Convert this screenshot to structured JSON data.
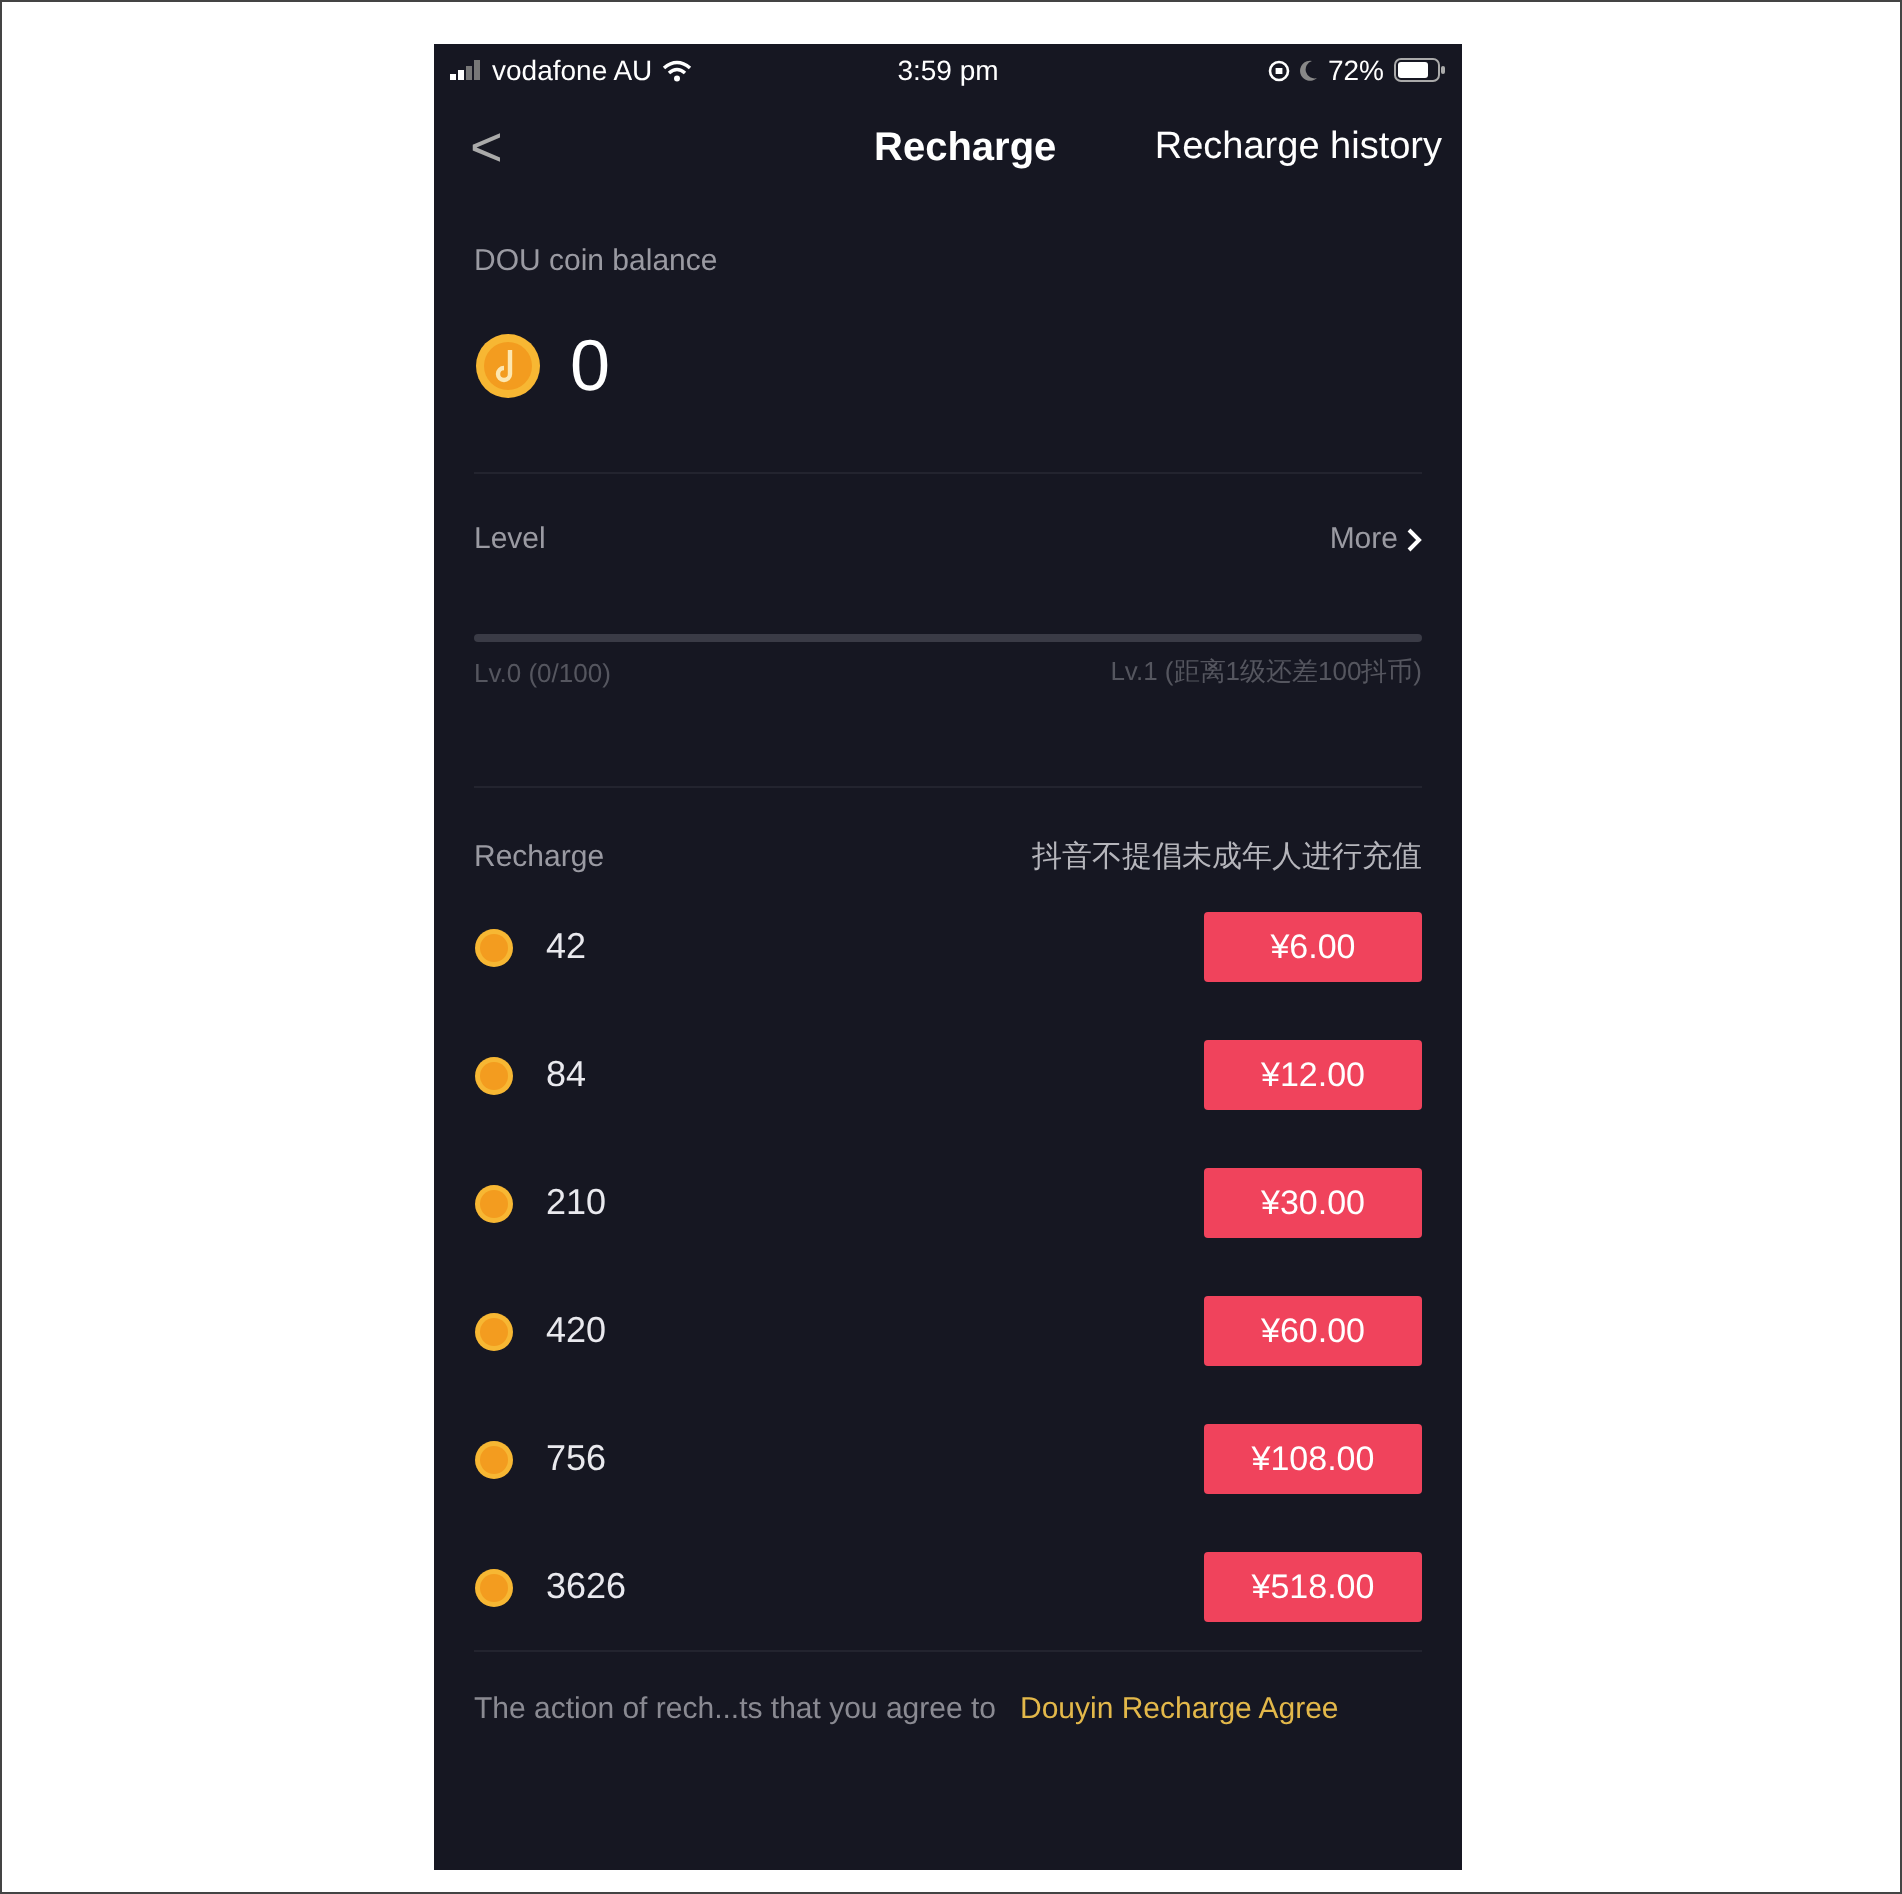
{
  "status_bar": {
    "carrier": "vodafone AU",
    "time": "3:59 pm",
    "battery": "72%"
  },
  "nav": {
    "back": "<",
    "title": "Recharge",
    "action": "Recharge history"
  },
  "balance": {
    "label": "DOU coin balance",
    "amount": "0"
  },
  "level": {
    "label": "Level",
    "more": "More",
    "level": 0,
    "current": "Lv.0 (0/100)",
    "next": "Lv.1 (距离1级还差100抖币)"
  },
  "recharge": {
    "label": "Recharge",
    "notice": "抖音不提倡未成年人进行充值",
    "options": [
      {
        "coins": "42",
        "price": "¥6.00"
      },
      {
        "coins": "84",
        "price": "¥12.00"
      },
      {
        "coins": "210",
        "price": "¥30.00"
      },
      {
        "coins": "420",
        "price": "¥60.00"
      },
      {
        "coins": "756",
        "price": "¥108.00"
      },
      {
        "coins": "3626",
        "price": "¥518.00"
      }
    ]
  },
  "footer": {
    "text": "The action of rech...ts that you agree to",
    "link": "Douyin Recharge Agree"
  }
}
